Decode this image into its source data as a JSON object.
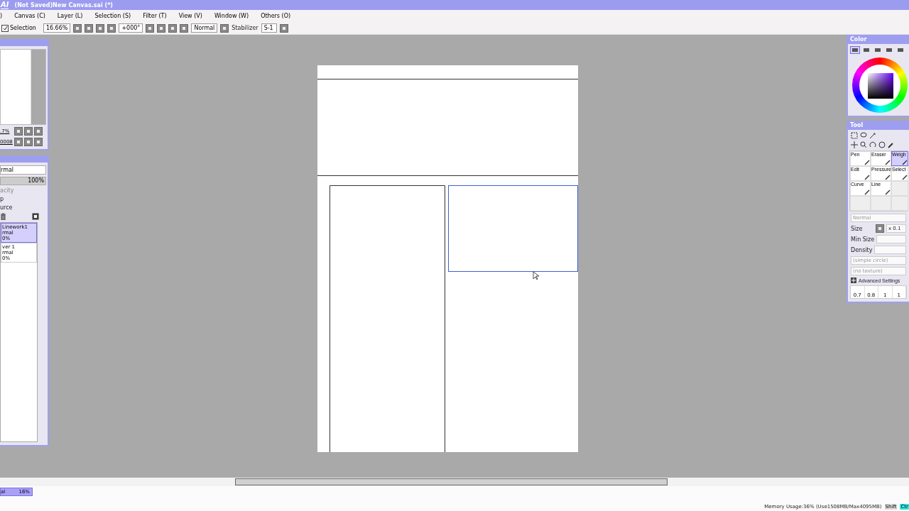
{
  "window": {
    "logo": "AI",
    "title": "(Not Saved)New Canvas.sai (*)"
  },
  "menu": [
    ")",
    "Canvas (C)",
    "Layer (L)",
    "Selection (S)",
    "Filter (T)",
    "View (V)",
    "Window (W)",
    "Others (O)"
  ],
  "toolbar": {
    "selection": {
      "label": "Selection",
      "checked": true
    },
    "zoom": "16.66%",
    "angle": "+000°",
    "blend": "Normal",
    "stabilizer_label": "Stabilizer",
    "stabilizer": "S-1"
  },
  "navigator": {
    "zoom": ".7%",
    "angle": "0008"
  },
  "layers": {
    "blend": "rmal",
    "opacity": "100%",
    "options": [
      {
        "label": "acity",
        "disabled": true
      },
      {
        "label": "p",
        "disabled": false
      },
      {
        "label": "urce",
        "disabled": false
      }
    ],
    "items": [
      {
        "name": "Linework1",
        "blend": "rmal",
        "opacity": "0%",
        "selected": true
      },
      {
        "name": "ver 1",
        "blend": "rmal",
        "opacity": "0%",
        "selected": false
      }
    ]
  },
  "color": {
    "title": "Color",
    "tabs": [
      {
        "selected": true
      },
      {
        "selected": false
      },
      {
        "selected": false
      },
      {
        "selected": false
      },
      {
        "selected": false
      }
    ]
  },
  "tool": {
    "title": "Tool",
    "brushes": [
      {
        "label": "Pen",
        "selected": false
      },
      {
        "label": "Eraser",
        "selected": false
      },
      {
        "label": "Weigh",
        "selected": true
      },
      {
        "label": "Edit",
        "selected": false
      },
      {
        "label": "Pressure",
        "selected": false
      },
      {
        "label": "Select",
        "selected": false
      },
      {
        "label": "Curve",
        "selected": false
      },
      {
        "label": "Line",
        "selected": false
      }
    ],
    "blend": {
      "value": "Normal",
      "disabled": true
    },
    "size_label": "Size",
    "size_multiplier": "x 0.1",
    "min_size_label": "Min Size",
    "density_label": "Density",
    "shape": {
      "value": "(simple circle)",
      "disabled": true
    },
    "texture": {
      "value": "(no texture)",
      "disabled": true
    },
    "advanced": "Advanced Settings",
    "presets": [
      "0.7",
      "0.8",
      "1",
      "1"
    ]
  },
  "status": {
    "layer_blend": "al",
    "layer_opacity": "16%",
    "memory": "Memory Usage:36% (Use1508MB/Max4095MB)",
    "keys": [
      {
        "label": "Shift",
        "on": false
      },
      {
        "label": "Ctr",
        "on": true
      }
    ]
  }
}
